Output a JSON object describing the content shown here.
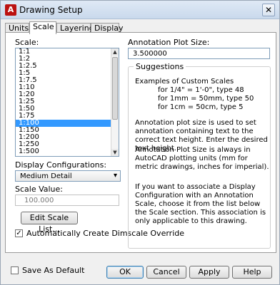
{
  "window": {
    "title": "Drawing Setup",
    "close_glyph": "✕"
  },
  "tabs": [
    {
      "label": "Units"
    },
    {
      "label": "Scale"
    },
    {
      "label": "Layering"
    },
    {
      "label": "Display"
    }
  ],
  "scale": {
    "label": "Scale:",
    "items": [
      "1:1",
      "1:2",
      "1:2.5",
      "1:5",
      "1:7.5",
      "1:10",
      "1:20",
      "1:25",
      "1:50",
      "1:75",
      "1:100",
      "1:150",
      "1:200",
      "1:250",
      "1:500"
    ],
    "selected_index": 10
  },
  "display_config": {
    "label": "Display Configurations:",
    "value": "Medium Detail"
  },
  "scale_value": {
    "label": "Scale Value:",
    "value": "100.000"
  },
  "buttons": {
    "edit_scale_list": "Edit Scale List...",
    "ok": "OK",
    "cancel": "Cancel",
    "apply": "Apply",
    "help": "Help"
  },
  "checkboxes": {
    "auto_dimscale": {
      "label": "Automatically Create Dimscale Override",
      "checked": true
    },
    "save_default": {
      "label": "Save As Default",
      "checked": false
    }
  },
  "annotation": {
    "label": "Annotation Plot Size:",
    "value": "3.500000"
  },
  "suggestions": {
    "title": "Suggestions",
    "examples_heading": "Examples of Custom Scales",
    "examples": [
      "for 1/4\" = 1'-0\", type 48",
      "for 1mm = 50mm, type 50",
      "for 1cm = 50cm, type 5"
    ],
    "para1": "Annotation plot size is used to set annotation containing text to the correct text height. Enter the desired text height.",
    "para2": "Annotation Plot Size is always in AutoCAD plotting units (mm for metric drawings, inches for imperial).",
    "para3": "If you want to associate a Display Configuration with an Annotation Scale, choose it from the list below the Scale section. This association is only applicable to this drawing."
  },
  "icons": {
    "app": "autocad-a-icon",
    "dropdown": "chevron-down-icon",
    "check": "checkmark-icon"
  },
  "colors": {
    "selection": "#3399ff",
    "titlebar": "#c9d9ec"
  }
}
